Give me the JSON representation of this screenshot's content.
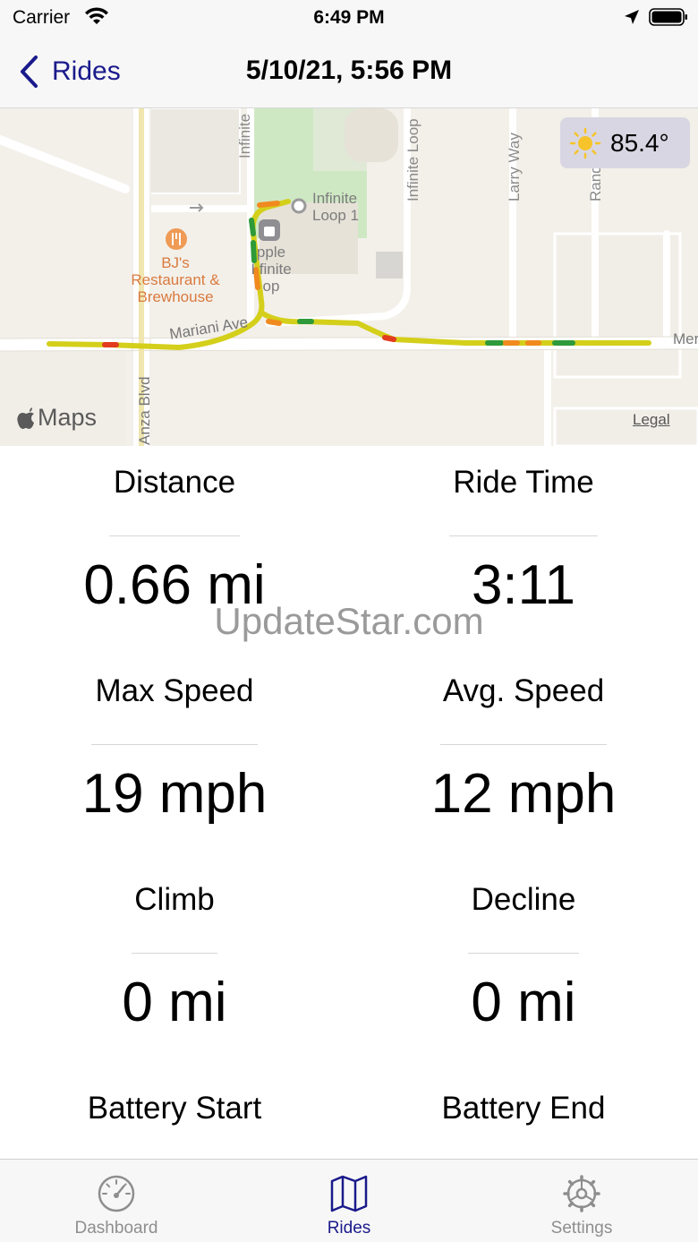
{
  "status_bar": {
    "carrier": "Carrier",
    "time": "6:49 PM"
  },
  "nav": {
    "back_label": "Rides",
    "title": "5/10/21, 5:56 PM"
  },
  "map": {
    "weather_temp": "85.4°",
    "maps_brand": "Maps",
    "legal": "Legal",
    "street_labels": {
      "infinite_vertical": "Infinite",
      "infinite_loop": "Infinite Loop",
      "larry_way": "Larry Way",
      "randy": "Randy L",
      "mariani_ave": "Mariani Ave",
      "anza_blvd": "Anza Blvd",
      "mer": "Mer"
    },
    "poi": {
      "restaurant_line1": "BJ's",
      "restaurant_line2": "Restaurant &",
      "restaurant_line3": "Brewhouse",
      "loop_line1": "Infinite",
      "loop_line2": "Loop 1",
      "apple_line1": "pple",
      "apple_line2": "I  finite",
      "apple_line3": "op"
    },
    "colors": {
      "route_yellow": "#d4cf1a",
      "route_orange": "#f08a1e",
      "route_red": "#e23b1e",
      "route_green": "#2e9a3a",
      "park": "#cfe8c4"
    }
  },
  "stats": {
    "distance": {
      "label": "Distance",
      "value": "0.66 mi"
    },
    "ride_time": {
      "label": "Ride Time",
      "value": "3:11"
    },
    "max_speed": {
      "label": "Max Speed",
      "value": "19 mph"
    },
    "avg_speed": {
      "label": "Avg. Speed",
      "value": "12 mph"
    },
    "climb": {
      "label": "Climb",
      "value": "0 mi"
    },
    "decline": {
      "label": "Decline",
      "value": "0 mi"
    },
    "battery_start": {
      "label": "Battery Start"
    },
    "battery_end": {
      "label": "Battery End"
    }
  },
  "watermark": "UpdateStar.com",
  "tabs": [
    {
      "label": "Dashboard",
      "icon": "speedometer-icon"
    },
    {
      "label": "Rides",
      "icon": "map-icon"
    },
    {
      "label": "Settings",
      "icon": "gear-icon"
    }
  ],
  "accent_color": "#1a1a8c"
}
